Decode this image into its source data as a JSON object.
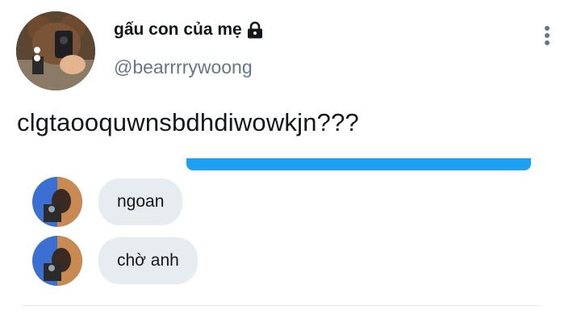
{
  "tweet": {
    "display_name": "gấu con của mẹ",
    "handle": "@bearrrrywoong",
    "text": "clgtaooquwnsbdhdiwowkjn???",
    "protected_icon": "lock-icon",
    "menu_icon": "more-vertical-icon"
  },
  "embedded_chat": {
    "messages": [
      {
        "text": "ngoan"
      },
      {
        "text": "chờ anh"
      }
    ],
    "colors": {
      "sent_bubble": "#1da1f2",
      "received_bubble": "#e6ecf0"
    }
  }
}
